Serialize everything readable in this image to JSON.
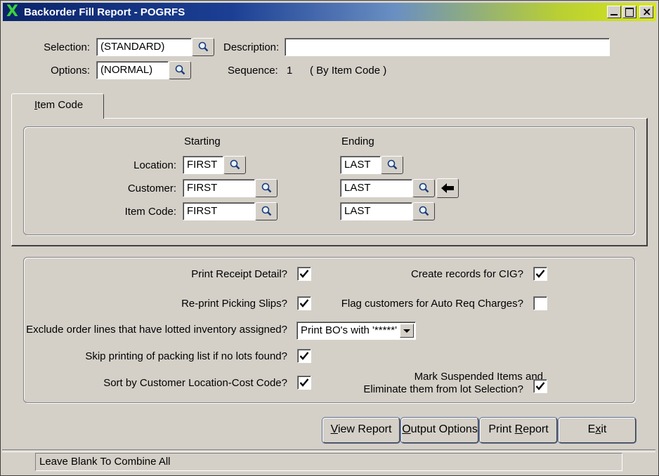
{
  "window": {
    "title": "Backorder Fill Report - POGRFS"
  },
  "header": {
    "selection_label": "Selection:",
    "selection_value": "(STANDARD)",
    "description_label": "Description:",
    "description_value": "",
    "options_label": "Options:",
    "options_value": "(NORMAL)",
    "sequence_label": "Sequence:",
    "sequence_value": "1",
    "sequence_desc": "( By Item Code )"
  },
  "tabs": [
    {
      "label": "Item Code",
      "selected": true
    }
  ],
  "range": {
    "starting_header": "Starting",
    "ending_header": "Ending",
    "rows": [
      {
        "label": "Location:",
        "start": "FIRST",
        "end": "LAST"
      },
      {
        "label": "Customer:",
        "start": "FIRST",
        "end": "LAST"
      },
      {
        "label": "Item Code:",
        "start": "FIRST",
        "end": "LAST"
      }
    ]
  },
  "options": {
    "print_receipt_detail": {
      "label": "Print Receipt Detail?",
      "checked": true
    },
    "reprint_picking_slips": {
      "label": "Re-print Picking Slips?",
      "checked": true
    },
    "exclude_lotted": {
      "label": "Exclude order lines that have lotted inventory assigned?",
      "value": "Print BO's with '*****'"
    },
    "skip_packing_list": {
      "label": "Skip printing of packing list if no lots found?",
      "checked": true
    },
    "sort_by_customer": {
      "label": "Sort by Customer Location-Cost Code?",
      "checked": true
    },
    "create_cig": {
      "label": "Create records for CIG?",
      "checked": true
    },
    "flag_auto_req": {
      "label": "Flag customers for Auto Req Charges?",
      "checked": false
    },
    "mark_suspended_line1": "Mark Suspended Items and",
    "mark_suspended_line2": "Eliminate them from lot Selection?",
    "mark_suspended_checked": true
  },
  "buttons": {
    "view_report": {
      "hot": "V",
      "rest": "iew Report"
    },
    "output_options": {
      "hot": "O",
      "rest": "utput Options"
    },
    "print_report_pre": "Print ",
    "print_report_hot": "R",
    "print_report_rest": "eport",
    "exit_pre": "E",
    "exit_hot": "x",
    "exit_rest": "it"
  },
  "status": {
    "text": "Leave Blank To Combine All"
  },
  "icons": {
    "lookup": "magnifier-icon",
    "arrow": "arrow-left-icon"
  }
}
